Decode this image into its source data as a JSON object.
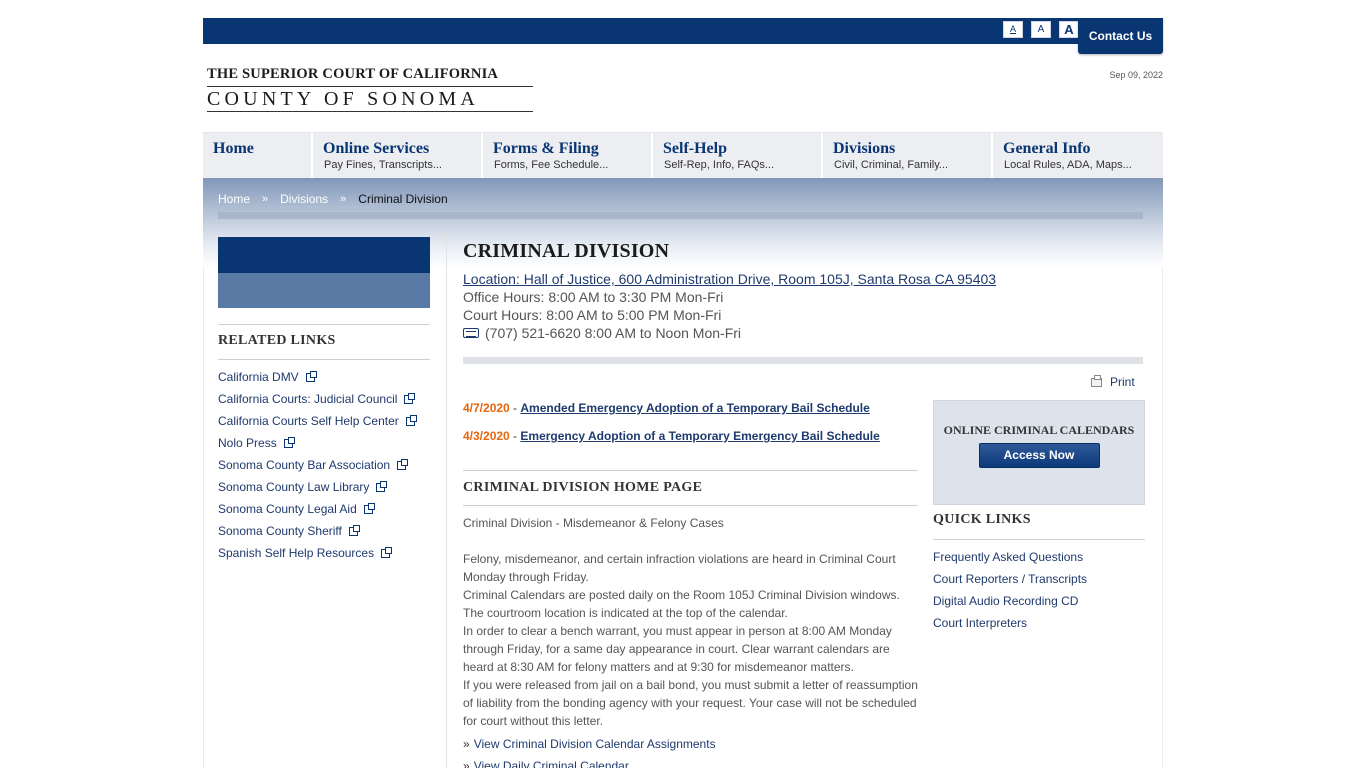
{
  "header": {
    "font_sizes": [
      "A",
      "A",
      "A"
    ],
    "contact_label": "Contact Us",
    "logo_line1": "THE SUPERIOR COURT OF CALIFORNIA",
    "logo_line2": "COUNTY OF SONOMA",
    "date": "Sep 09, 2022"
  },
  "nav": [
    {
      "title": "Home",
      "sub": ""
    },
    {
      "title": "Online Services",
      "sub": "Pay Fines, Transcripts..."
    },
    {
      "title": "Forms & Filing",
      "sub": "Forms, Fee Schedule..."
    },
    {
      "title": "Self-Help",
      "sub": "Self-Rep, Info, FAQs..."
    },
    {
      "title": "Divisions",
      "sub": "Civil, Criminal, Family..."
    },
    {
      "title": "General Info",
      "sub": "Local Rules, ADA, Maps..."
    }
  ],
  "breadcrumb": {
    "home": "Home",
    "sep": "»",
    "divisions": "Divisions",
    "current": "Criminal Division"
  },
  "sidebar": {
    "heading": "RELATED LINKS",
    "links": [
      "California DMV",
      "California Courts: Judicial Council",
      "California Courts Self Help Center",
      "Nolo Press",
      "Sonoma County Bar Association",
      "Sonoma County Law Library",
      "Sonoma County Legal Aid",
      "Sonoma County Sheriff",
      "Spanish Self Help Resources"
    ]
  },
  "main": {
    "title": "CRIMINAL DIVISION",
    "location": "Location: Hall of Justice, 600 Administration Drive, Room 105J, Santa Rosa CA 95403",
    "office_hours": "Office Hours: 8:00 AM to 3:30 PM Mon-Fri",
    "court_hours": "Court Hours: 8:00 AM to 5:00 PM Mon-Fri",
    "phone": "(707) 521-6620 8:00 AM to Noon Mon-Fri",
    "print_label": "Print",
    "notices": [
      {
        "date": "4/7/2020",
        "dash": " - ",
        "title": "Amended Emergency Adoption of a Temporary Bail Schedule"
      },
      {
        "date": "4/3/2020",
        "dash": " - ",
        "title": "Emergency Adoption of a Temporary Emergency Bail Schedule"
      }
    ],
    "home_heading": "CRIMINAL DIVISION HOME PAGE",
    "subheading": "Criminal Division - Misdemeanor & Felony Cases",
    "paragraphs": [
      "Felony, misdemeanor, and certain infraction violations are heard in Criminal Court Monday through Friday.",
      "Criminal Calendars are posted daily on the Room 105J Criminal Division windows. The courtroom location is indicated at the top of the calendar.",
      "In order to clear a bench warrant, you must appear in person at 8:00 AM Monday through Friday, for a same day appearance in court.  Clear warrant calendars are heard at 8:30 AM for felony matters and at 9:30 for misdemeanor matters.",
      "If you were released from jail on a bail bond, you must submit a letter of reassumption of liability from the bonding agency with your request. Your case will not be scheduled for court without this letter."
    ],
    "more_links": [
      "View Criminal Division Calendar Assignments",
      "View Daily Criminal Calendar"
    ]
  },
  "right": {
    "calendar_title": "ONLINE CRIMINAL CALENDARS",
    "access_label": "Access Now",
    "quick_heading": "QUICK LINKS",
    "quick_links": [
      "Frequently Asked Questions",
      "Court Reporters / Transcripts",
      "Digital Audio Recording CD",
      "Court Interpreters"
    ]
  },
  "colors": {
    "brand_navy": "#0a3573",
    "link": "#1f3a6e",
    "notice_date": "#e8650a"
  }
}
